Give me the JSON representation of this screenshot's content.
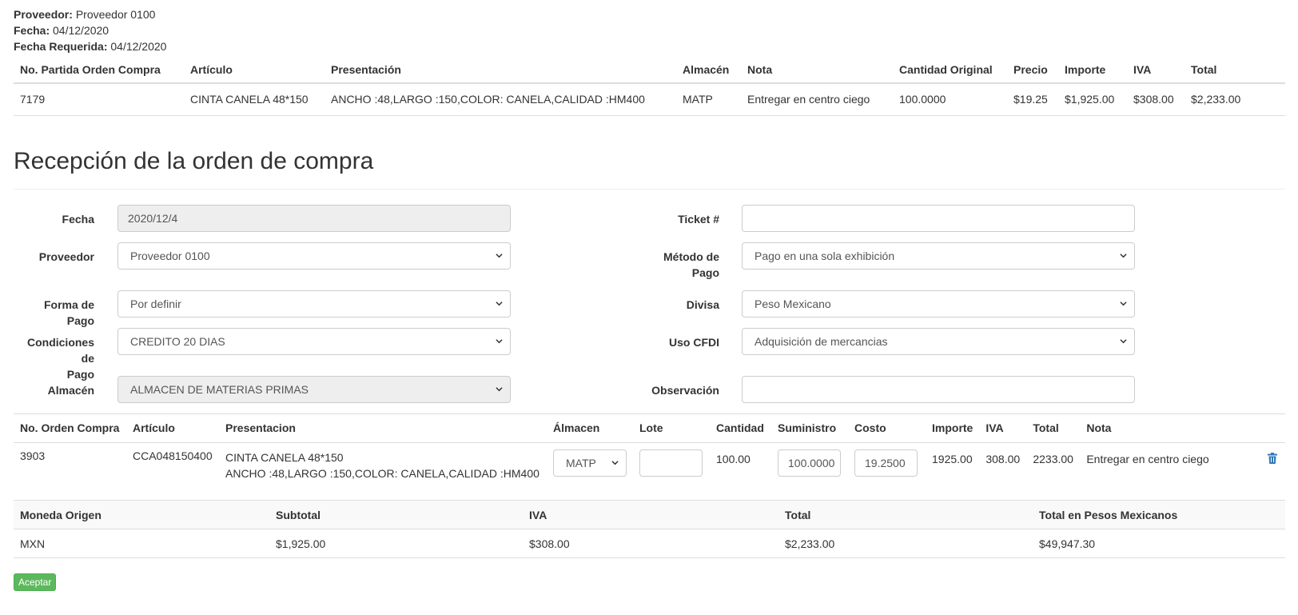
{
  "header": {
    "proveedor_label": "Proveedor:",
    "proveedor_value": "Proveedor 0100",
    "fecha_label": "Fecha:",
    "fecha_value": "04/12/2020",
    "fecha_req_label": "Fecha Requerida:",
    "fecha_req_value": "04/12/2020"
  },
  "po_table": {
    "columns": [
      "No. Partida Orden Compra",
      "Artículo",
      "Presentación",
      "Almacén",
      "Nota",
      "Cantidad Original",
      "Precio",
      "Importe",
      "IVA",
      "Total"
    ],
    "row": [
      "7179",
      "CINTA CANELA 48*150",
      "ANCHO :48,LARGO :150,COLOR: CANELA,CALIDAD :HM400",
      "MATP",
      "Entregar en centro ciego",
      "100.0000",
      "$19.25",
      "$1,925.00",
      "$308.00",
      "$2,233.00"
    ]
  },
  "section_title": "Recepción de la orden de compra",
  "form": {
    "fecha_label": "Fecha",
    "fecha_value": "2020/12/4",
    "ticket_label": "Ticket #",
    "ticket_value": "",
    "proveedor_label": "Proveedor",
    "proveedor_value": "Proveedor 0100",
    "metodo_label_1": "Método de",
    "metodo_label_2": "Pago",
    "metodo_value": "Pago en una sola exhibición",
    "forma_label": "Forma de Pago",
    "forma_value": "Por definir",
    "divisa_label": "Divisa",
    "divisa_value": "Peso Mexicano",
    "condiciones_label_1": "Condiciones de",
    "condiciones_label_2": "Pago",
    "condiciones_value": "CREDITO 20 DIAS",
    "uso_label": "Uso CFDI",
    "uso_value": "Adquisición de mercancias",
    "almacen_label": "Almacén",
    "almacen_value": "ALMACEN DE MATERIAS PRIMAS",
    "observacion_label": "Observación",
    "observacion_value": ""
  },
  "rec_table": {
    "columns": [
      "No. Orden Compra",
      "Artículo",
      "Presentacion",
      "Álmacen",
      "Lote",
      "Cantidad",
      "Suministro",
      "Costo",
      "Importe",
      "IVA",
      "Total",
      "Nota"
    ],
    "row": {
      "orden": "3903",
      "articulo": "CCA048150400",
      "presentacion_1": "CINTA CANELA 48*150",
      "presentacion_2": "ANCHO :48,LARGO :150,COLOR: CANELA,CALIDAD :HM400",
      "almacen": "MATP",
      "lote": "",
      "cantidad": "100.00",
      "suministro": "100.0000",
      "costo": "19.2500",
      "importe": "1925.00",
      "iva": "308.00",
      "total": "2233.00",
      "nota": "Entregar en centro ciego"
    }
  },
  "totals": {
    "columns": [
      "Moneda Origen",
      "Subtotal",
      "IVA",
      "Total",
      "Total en Pesos Mexicanos"
    ],
    "row": [
      "MXN",
      "$1,925.00",
      "$308.00",
      "$2,233.00",
      "$49,947.30"
    ]
  },
  "accept_button": "Aceptar",
  "colors": {
    "accept_button": "#5cb85c",
    "trash_icon": "#337ab7",
    "disabled_field": "#eeeeee"
  }
}
